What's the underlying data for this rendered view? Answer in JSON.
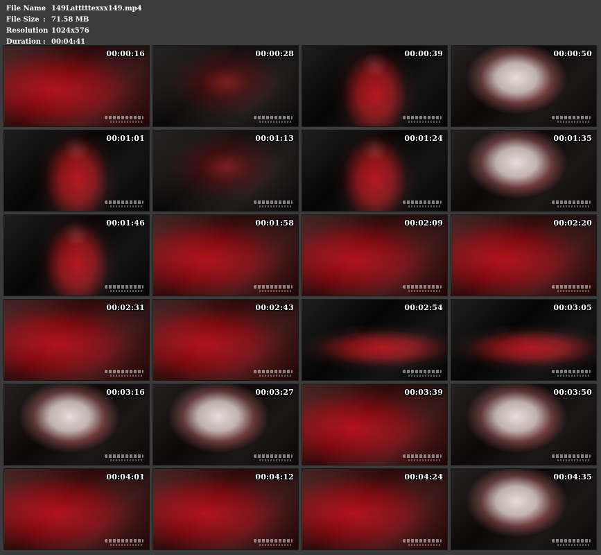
{
  "file_info": {
    "name_label": "File Name",
    "name_value": "149Latttttexxx149.mp4",
    "size_label": "File Size",
    "size_value": "71.58 MB",
    "resolution_label": "Resolution",
    "resolution_value": "1024x576",
    "duration_label": "Duration",
    "duration_value": "00:04:41",
    "separator": ":"
  },
  "frames": [
    {
      "time": "00:00:16",
      "scene": "red-closeup"
    },
    {
      "time": "00:00:28",
      "scene": "dark-figure"
    },
    {
      "time": "00:00:39",
      "scene": "standing-figure"
    },
    {
      "time": "00:00:50",
      "scene": "face-closeup"
    },
    {
      "time": "00:01:01",
      "scene": "standing-figure"
    },
    {
      "time": "00:01:13",
      "scene": "dark-figure"
    },
    {
      "time": "00:01:24",
      "scene": "standing-figure"
    },
    {
      "time": "00:01:35",
      "scene": "face-closeup"
    },
    {
      "time": "00:01:46",
      "scene": "standing-figure"
    },
    {
      "time": "00:01:58",
      "scene": "red-closeup"
    },
    {
      "time": "00:02:09",
      "scene": "red-closeup"
    },
    {
      "time": "00:02:20",
      "scene": "red-closeup"
    },
    {
      "time": "00:02:31",
      "scene": "red-closeup"
    },
    {
      "time": "00:02:43",
      "scene": "red-closeup"
    },
    {
      "time": "00:02:54",
      "scene": "reclining-figure"
    },
    {
      "time": "00:03:05",
      "scene": "reclining-figure"
    },
    {
      "time": "00:03:16",
      "scene": "face-closeup"
    },
    {
      "time": "00:03:27",
      "scene": "face-closeup"
    },
    {
      "time": "00:03:39",
      "scene": "red-closeup"
    },
    {
      "time": "00:03:50",
      "scene": "face-closeup"
    },
    {
      "time": "00:04:01",
      "scene": "red-closeup"
    },
    {
      "time": "00:04:12",
      "scene": "red-closeup"
    },
    {
      "time": "00:04:24",
      "scene": "red-closeup"
    },
    {
      "time": "00:04:35",
      "scene": "face-closeup"
    }
  ],
  "colors": {
    "background": "#3b3b3b",
    "header_text": "#ffffff",
    "thumb_dark": "#0b0b0b",
    "latex_red": "#b3121b",
    "plastic_white": "#e6dcd8"
  }
}
